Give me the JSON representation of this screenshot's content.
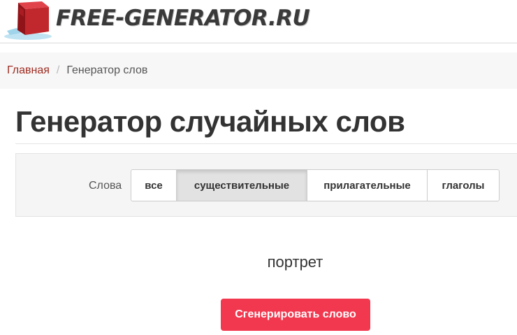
{
  "header": {
    "logo_text": "FREE-GENERATOR.RU",
    "logo_icon": "red-cube-icon"
  },
  "breadcrumb": {
    "home": "Главная",
    "separator": "/",
    "current": "Генератор слов"
  },
  "page": {
    "title": "Генератор случайных слов"
  },
  "filter": {
    "label": "Слова",
    "options": [
      "все",
      "существительные",
      "прилагательные",
      "глаголы"
    ],
    "selected": "существительные"
  },
  "result": {
    "word": "портрет"
  },
  "generate_button": {
    "label": "Сгенерировать слово"
  },
  "colors": {
    "accent": "#f2384f",
    "link": "#9e2c22",
    "logo_cube": "#c0282d"
  }
}
